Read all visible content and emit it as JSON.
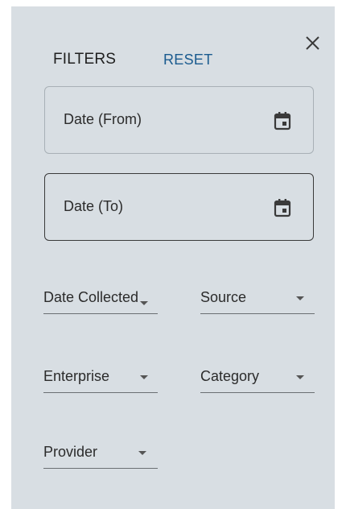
{
  "filters_panel": {
    "title": "FILTERS",
    "reset_label": "RESET",
    "close_icon": "close-icon",
    "date_from": {
      "label": "Date (From)",
      "icon": "calendar-icon"
    },
    "date_to": {
      "label": "Date (To)",
      "icon": "calendar-icon"
    },
    "selects": {
      "date_collected": {
        "label": "Date Collected",
        "icon": "chevron-down-icon"
      },
      "source": {
        "label": "Source",
        "icon": "chevron-down-icon"
      },
      "enterprise": {
        "label": "Enterprise",
        "icon": "chevron-down-icon"
      },
      "category": {
        "label": "Category",
        "icon": "chevron-down-icon"
      },
      "provider": {
        "label": "Provider",
        "icon": "chevron-down-icon"
      }
    }
  },
  "colors": {
    "panel_background": "#d8dee3",
    "reset_link": "#1a5b8f",
    "text": "#2b2b2b"
  }
}
